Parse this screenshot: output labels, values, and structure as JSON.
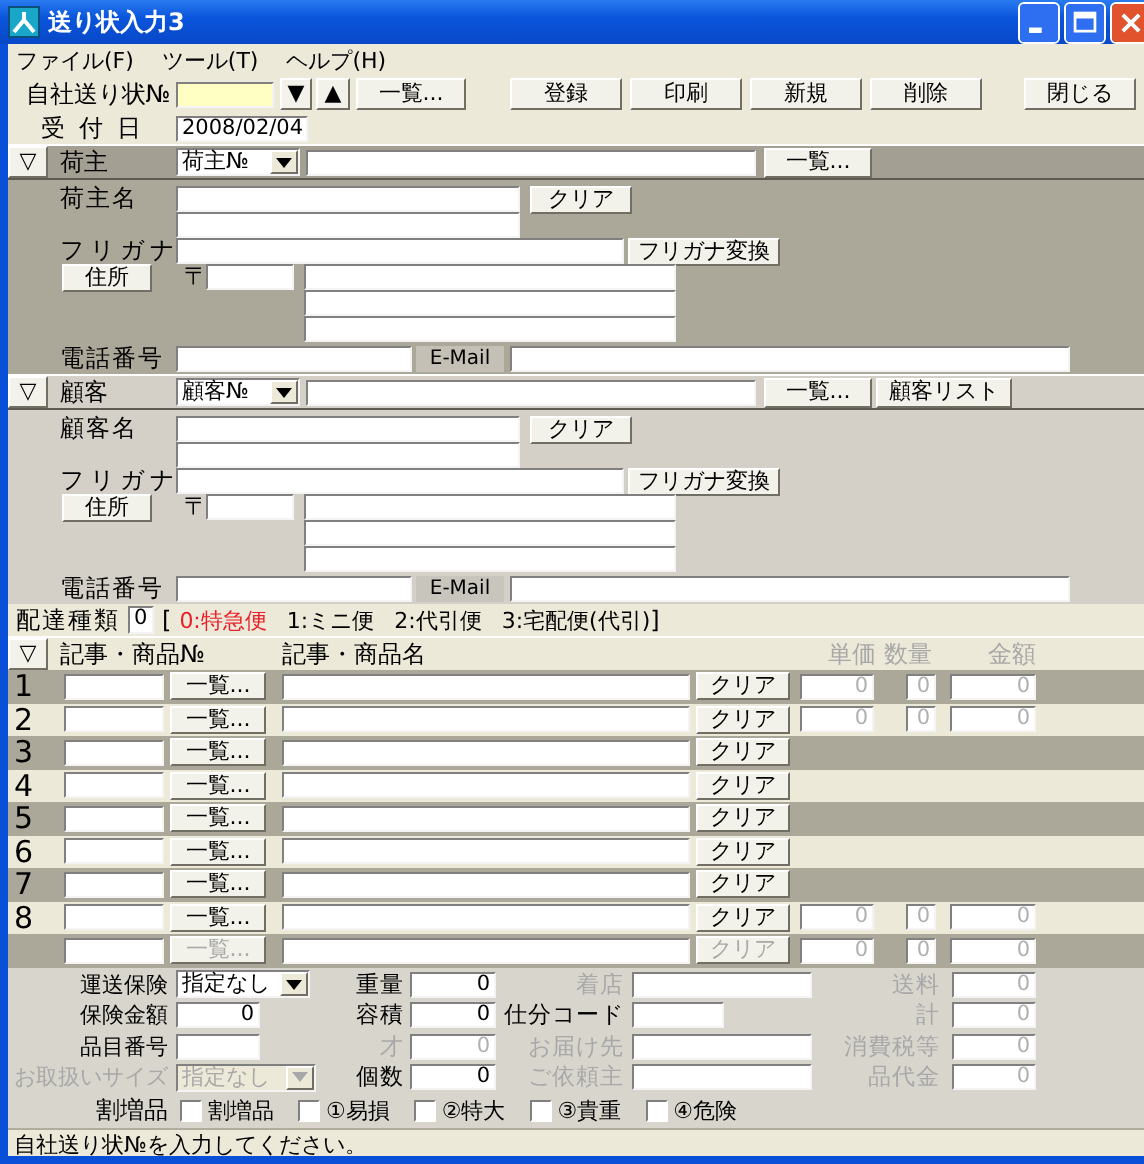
{
  "window": {
    "title": "送り状入力3"
  },
  "menu": [
    "ファイル(F)",
    "ツール(T)",
    "ヘルプ(H)"
  ],
  "toolbar": {
    "label": "自社送り状№",
    "down_button": "▼",
    "up_button": "▲",
    "list_button": "一覧...",
    "actions": [
      "登録",
      "印刷",
      "新規",
      "削除"
    ],
    "close_button": "閉じる"
  },
  "received_date": {
    "label": "受付日",
    "value": "2008/02/04"
  },
  "shipper": {
    "toggle": "▽",
    "title": "荷主",
    "selector": "荷主№",
    "list_button": "一覧...",
    "name_label": "荷主名",
    "clear_button": "クリア",
    "kana_label": "フリガナ",
    "kana_button": "フリガナ変換",
    "address_button": "住所",
    "postal_mark": "〒",
    "phone_label": "電話番号",
    "email_label": "E-Mail"
  },
  "customer": {
    "toggle": "▽",
    "title": "顧客",
    "selector": "顧客№",
    "list_button": "一覧...",
    "extra_button": "顧客リスト",
    "name_label": "顧客名",
    "clear_button": "クリア",
    "kana_label": "フリガナ",
    "kana_button": "フリガナ変換",
    "address_button": "住所",
    "postal_mark": "〒",
    "phone_label": "電話番号",
    "email_label": "E-Mail"
  },
  "delivery_type": {
    "label": "配達種類",
    "value": "0",
    "open": "[",
    "close": "]",
    "options": [
      {
        "text": "0:特急便",
        "selected": true
      },
      {
        "text": "1:ミニ便",
        "selected": false
      },
      {
        "text": "2:代引便",
        "selected": false
      },
      {
        "text": "3:宅配便(代引)",
        "selected": false
      }
    ]
  },
  "items": {
    "toggle": "▽",
    "columns": [
      {
        "text": "記事・商品№",
        "disabled": false
      },
      {
        "text": "記事・商品名",
        "disabled": false
      },
      {
        "text": "単価",
        "disabled": true
      },
      {
        "text": "数量",
        "disabled": true
      },
      {
        "text": "金額",
        "disabled": true
      }
    ],
    "rows": [
      {
        "number": "1",
        "list_button": "一覧...",
        "clear_button": "クリア",
        "disabled": false,
        "price": "0",
        "quantity": "0",
        "amount": "0"
      },
      {
        "number": "2",
        "list_button": "一覧...",
        "clear_button": "クリア",
        "disabled": false,
        "price": "0",
        "quantity": "0",
        "amount": "0"
      },
      {
        "number": "3",
        "list_button": "一覧...",
        "clear_button": "クリア",
        "disabled": false
      },
      {
        "number": "4",
        "list_button": "一覧...",
        "clear_button": "クリア",
        "disabled": false
      },
      {
        "number": "5",
        "list_button": "一覧...",
        "clear_button": "クリア",
        "disabled": false
      },
      {
        "number": "6",
        "list_button": "一覧...",
        "clear_button": "クリア",
        "disabled": false
      },
      {
        "number": "7",
        "list_button": "一覧...",
        "clear_button": "クリア",
        "disabled": false
      },
      {
        "number": "8",
        "list_button": "一覧...",
        "clear_button": "クリア",
        "disabled": false,
        "price": "0",
        "quantity": "0",
        "amount": "0"
      },
      {
        "list_button": "一覧...",
        "clear_button": "クリア",
        "disabled": true,
        "price": "0",
        "quantity": "0",
        "amount": "0"
      }
    ]
  },
  "details": {
    "columns": [
      [
        {
          "label": "運送保険",
          "kind": "select",
          "value": "指定なし",
          "disabled": false
        },
        {
          "label": "保険金額",
          "kind": "field",
          "value": "0",
          "disabled": false
        },
        {
          "label": "品目番号",
          "kind": "field",
          "disabled": false
        },
        {
          "label": "お取扱いサイズ",
          "kind": "select",
          "value": "指定なし",
          "disabled": true
        }
      ],
      [
        {
          "label": "重量",
          "kind": "field",
          "value": "0",
          "disabled": false
        },
        {
          "label": "容積",
          "kind": "field",
          "value": "0",
          "disabled": false
        },
        {
          "label": "才",
          "kind": "field",
          "value": "0",
          "disabled": true
        },
        {
          "label": "個数",
          "kind": "field",
          "value": "0",
          "disabled": false
        }
      ],
      [
        {
          "label": "着店",
          "kind": "field",
          "disabled": true
        },
        {
          "label": "仕分コード",
          "kind": "field",
          "disabled": false
        },
        {
          "label": "お届け先",
          "kind": "field",
          "disabled": true
        },
        {
          "label": "ご依頼主",
          "kind": "field",
          "disabled": true
        }
      ],
      [
        {
          "label": "送料",
          "kind": "field",
          "value": "0",
          "disabled": true
        },
        {
          "label": "計",
          "kind": "field",
          "value": "0",
          "disabled": true
        },
        {
          "label": "消費税等",
          "kind": "field",
          "value": "0",
          "disabled": true
        },
        {
          "label": "品代金",
          "kind": "field",
          "value": "0",
          "disabled": true
        }
      ]
    ]
  },
  "surcharge": {
    "label": "割増品",
    "options": [
      {
        "text": "割増品",
        "checked": false
      },
      {
        "text": "①易損",
        "checked": false
      },
      {
        "text": "②特大",
        "checked": false
      },
      {
        "text": "③貴重",
        "checked": false
      },
      {
        "text": "④危険",
        "checked": false
      }
    ]
  },
  "status_bar": "自社送り状№を入力してください。"
}
